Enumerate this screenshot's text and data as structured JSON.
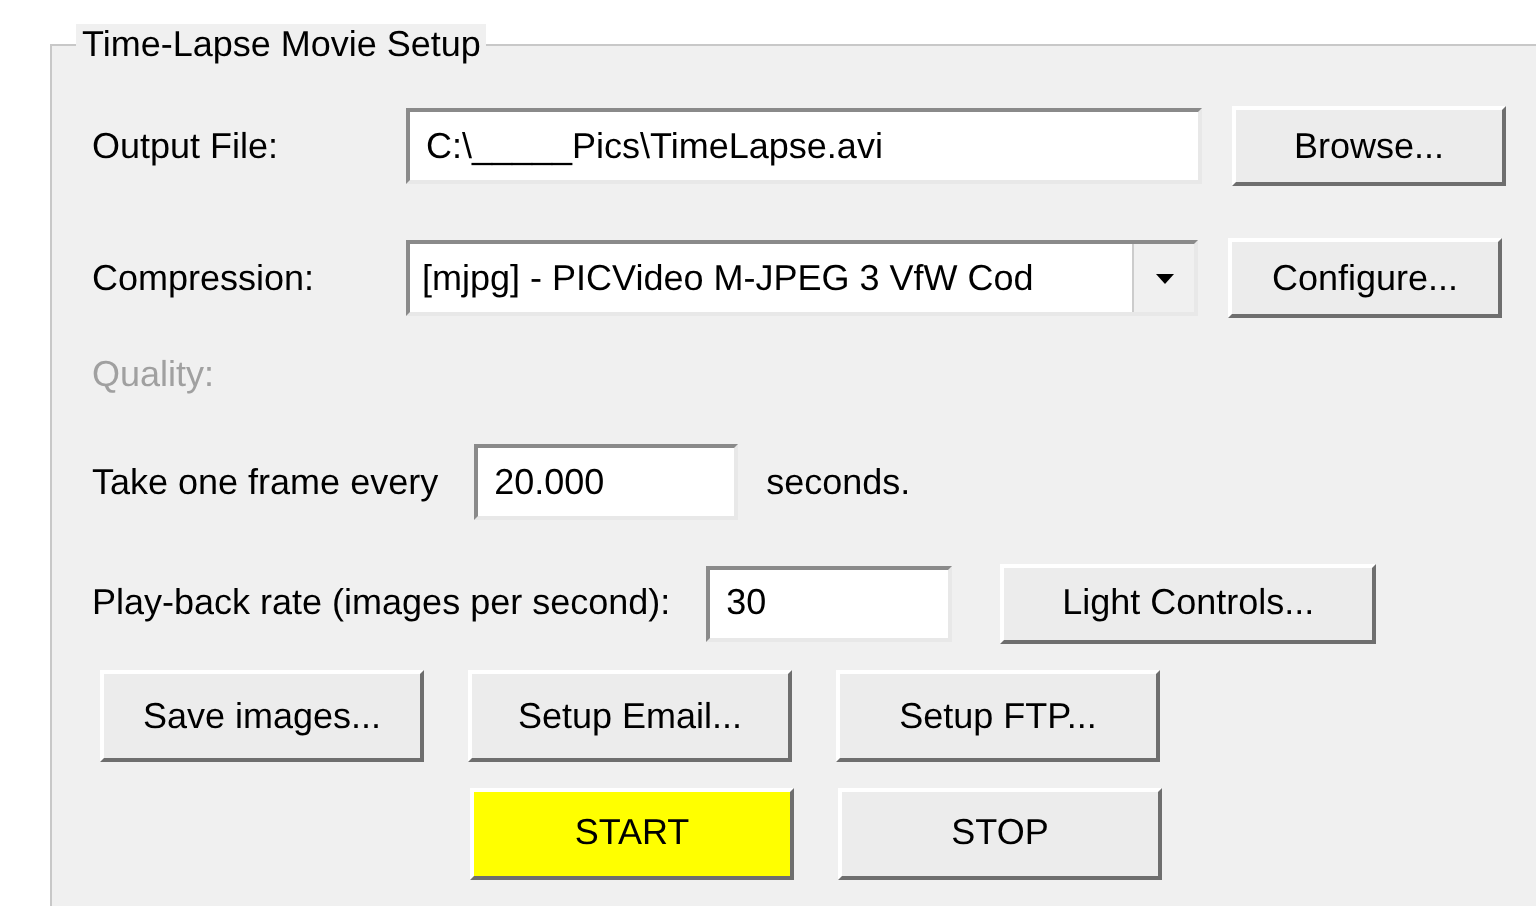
{
  "group": {
    "title": "Time-Lapse Movie Setup"
  },
  "output_file": {
    "label": "Output File:",
    "value": "C:\\_____Pics\\TimeLapse.avi",
    "button": "Browse..."
  },
  "compression": {
    "label": "Compression:",
    "value": "[mjpg] - PICVideo M-JPEG 3 VfW Cod",
    "button": "Configure..."
  },
  "quality": {
    "label": "Quality:",
    "disabled": true
  },
  "interval": {
    "label": "Take one frame every",
    "value": "20.000",
    "unit": "seconds."
  },
  "playback": {
    "label": "Play-back rate (images per second):",
    "value": "30",
    "button": "Light Controls..."
  },
  "setup_buttons": [
    {
      "label": "Save images..."
    },
    {
      "label": "Setup Email..."
    },
    {
      "label": "Setup FTP..."
    }
  ],
  "run_buttons": [
    {
      "label": "START",
      "highlighted": true
    },
    {
      "label": "STOP",
      "highlighted": false
    }
  ]
}
